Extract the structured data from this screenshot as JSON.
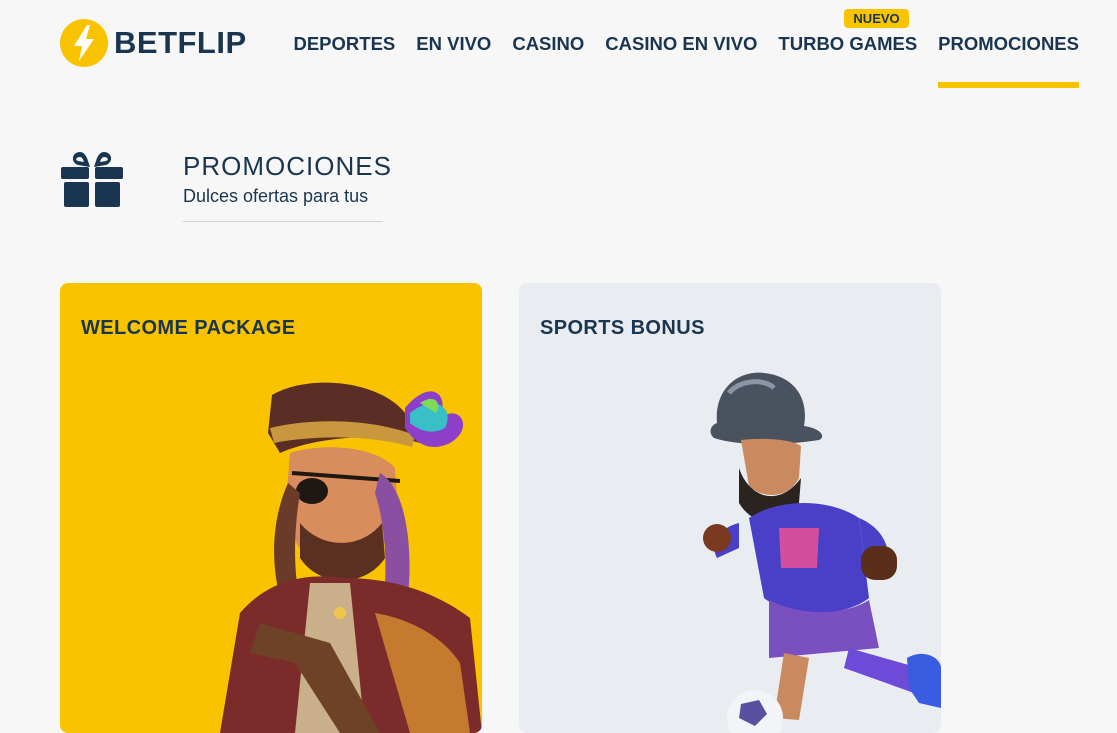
{
  "brand": {
    "name": "BETFLIP",
    "accent": "#f9c300",
    "text_color": "#1a3550"
  },
  "nav": {
    "items": [
      {
        "label": "DEPORTES"
      },
      {
        "label": "EN VIVO"
      },
      {
        "label": "CASINO"
      },
      {
        "label": "CASINO EN VIVO"
      },
      {
        "label": "TURBO GAMES",
        "badge": "NUEVO"
      },
      {
        "label": "PROMOCIONES",
        "active": true
      }
    ]
  },
  "page": {
    "icon": "gift-icon",
    "title": "PROMOCIONES",
    "subtitle": "Dulces ofertas para tus"
  },
  "cards": [
    {
      "title": "WELCOME PACKAGE",
      "background": "#f9c300",
      "image": "pirate-character"
    },
    {
      "title": "SPORTS BONUS",
      "background": "#e9ecf1",
      "image": "conquistador-footballer-character"
    }
  ]
}
